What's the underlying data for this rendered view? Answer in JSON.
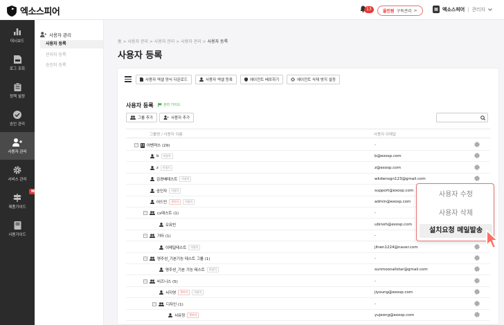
{
  "brand": {
    "name": "엑소스피어"
  },
  "header": {
    "notification_count": "13",
    "plan_badge": "올인원",
    "plan_label": "구독관리",
    "plan_chevron": ">",
    "company": "엑소스피어",
    "separator": "|",
    "role": "관리자"
  },
  "sidebar": {
    "items": [
      {
        "label": "대시보드",
        "icon": "bar-chart-icon"
      },
      {
        "label": "로그 조회",
        "icon": "log-icon"
      },
      {
        "label": "정책 설정",
        "icon": "clipboard-icon"
      },
      {
        "label": "승인 관리",
        "icon": "check-circle-icon"
      },
      {
        "label": "사용자 관리",
        "icon": "user-plus-icon"
      },
      {
        "label": "서비스 관리",
        "icon": "gear-icon"
      },
      {
        "label": "제품가이드",
        "icon": "signpost-icon"
      },
      {
        "label": "사용가이드",
        "icon": "book-icon"
      }
    ],
    "new_badge": "NEW"
  },
  "subnav": {
    "group": "사용자 관리",
    "items": [
      "사용자 등록",
      "관리자 등록",
      "승인자 등록"
    ]
  },
  "breadcrumb": {
    "home": "홈",
    "sep": ">",
    "part1": "사용자 관리",
    "part2": "사용자 관리",
    "part3": "사용자 관리",
    "current": "사용자 등록"
  },
  "page": {
    "title": "사용자 등록"
  },
  "toolbar": {
    "btn1": "사용자 엑셀 양식 다운로드",
    "btn2": "사용자 엑셀 등록",
    "btn3": "에이전트 배포하기",
    "btn4": "에이전트 삭제 방지 설정"
  },
  "section": {
    "title": "사용자 등록",
    "guide": "관리 가이드",
    "add_group": "그룹 추가",
    "add_user": "사용자 추가"
  },
  "table": {
    "col_name": "그룹명 / 사용자 이름",
    "col_email": "사용자 이메일",
    "rows": [
      {
        "name": "어벤져스 (29)",
        "email": "-",
        "tag": ""
      },
      {
        "name": "b",
        "email": "b@exosp.com",
        "tag": "미설치"
      },
      {
        "name": "z",
        "email": "z@exosp.com",
        "tag": "미설치"
      },
      {
        "name": "김경배테스트",
        "email": "wkdwnsgn123@gmail.com",
        "tag": "미설치"
      },
      {
        "name": "승인자",
        "email": "support@exosp.com",
        "tag": "미설치"
      },
      {
        "name": "어드민",
        "email": "admin@exosp.com",
        "tag": "관리자",
        "tag2": "미설치"
      },
      {
        "name": "cx테스트 (1)",
        "email": "-",
        "tag": ""
      },
      {
        "name": "오유빈",
        "email": "ubinoh@exosp.com",
        "tag": ""
      },
      {
        "name": "기타 (1)",
        "email": "-",
        "tag": ""
      },
      {
        "name": "이메일테스트",
        "email": "jihwn1224@naver.com",
        "tag": "미설치"
      },
      {
        "name": "명주성_기본기능 테스트 그룹 (1)",
        "email": "-",
        "tag": ""
      },
      {
        "name": "명주성_기본 기능 테스트",
        "email": "sunmoonallstar@gmail.com",
        "tag": "미설치"
      },
      {
        "name": "비즈니스 (5)",
        "email": "-",
        "tag": ""
      },
      {
        "name": "서지영",
        "email": "jiyoung@exosp.com",
        "tag": "관리자",
        "tag2": "미설치"
      },
      {
        "name": "디자인 (1)",
        "email": "-",
        "tag": ""
      },
      {
        "name": "서유정",
        "email": "yujeong@exosp.com",
        "tag": "관리자"
      }
    ],
    "toggle_minus": "−"
  },
  "context_menu": {
    "items": [
      "사용자 수정",
      "사용자 삭제",
      "설치요청 메일발송"
    ]
  }
}
